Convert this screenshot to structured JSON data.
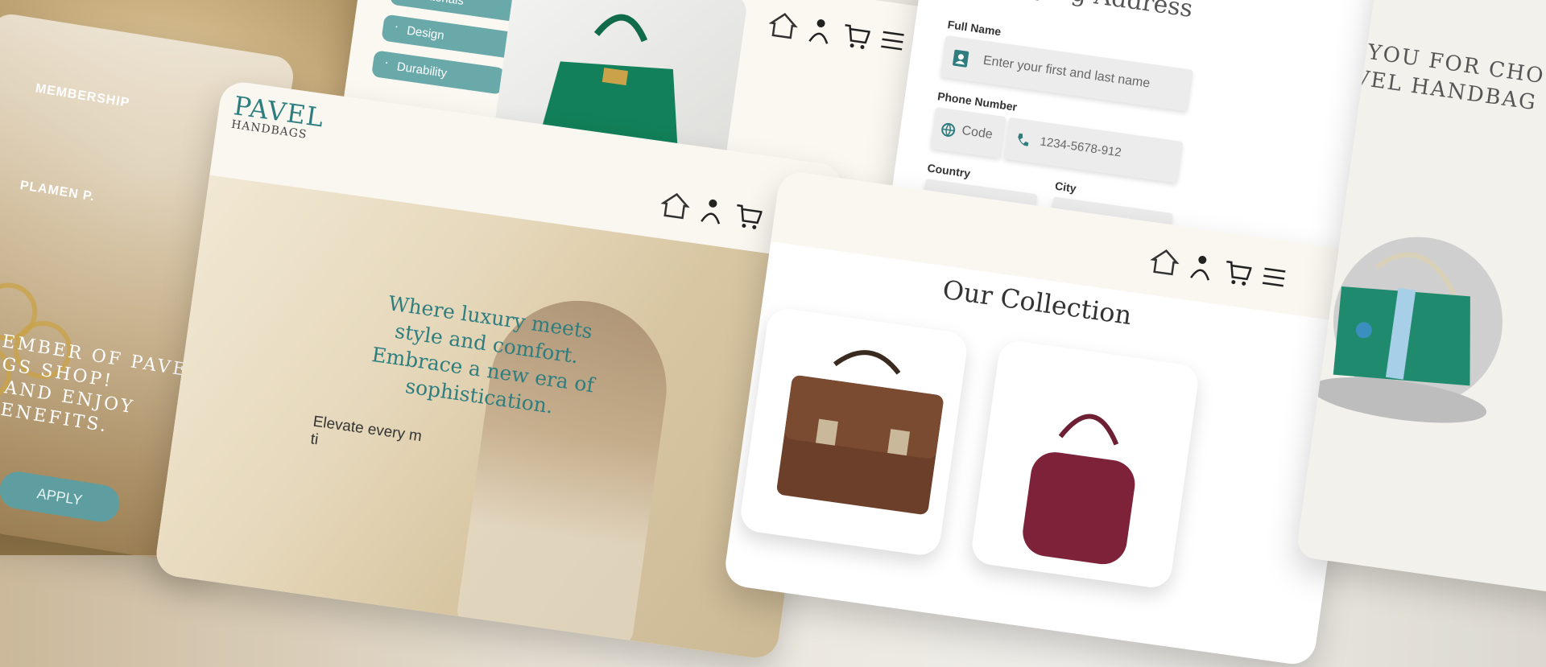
{
  "membership": {
    "label": "MEMBERSHIP",
    "name": "PLAMEN P.",
    "promo_line1": "A MEMBER OF PAVEL",
    "promo_line2": "DBAGS SHOP!",
    "promo_line3": "DAY AND ENJOY",
    "promo_line4": "AL BENEFITS.",
    "apply_label": "APPLY"
  },
  "product_page": {
    "menu": [
      "Materials",
      "Design",
      "Durability"
    ]
  },
  "brand": {
    "logo_top": "PAVEL",
    "logo_bottom": "HANDBAGS",
    "accent": "#2f7d7e"
  },
  "shipping": {
    "title": "Shipping Address",
    "full_name_label": "Full Name",
    "full_name_placeholder": "Enter your first and last name",
    "phone_label": "Phone Number",
    "code_placeholder": "Code",
    "phone_placeholder": "1234-5678-912",
    "country_label": "Country",
    "city_label": "City"
  },
  "hero": {
    "headline_1": "Where luxury meets",
    "headline_2": "style and comfort.",
    "headline_3": "Embrace a new era of",
    "headline_4": "sophistication.",
    "body_1": "Elevate every m",
    "body_2": "ti"
  },
  "collection": {
    "title": "Our Collection"
  },
  "thanks": {
    "line1": "K YOU FOR CHO",
    "line2": "AVEL HANDBAG"
  },
  "icons": [
    "home-icon",
    "user-icon",
    "cart-icon",
    "menu-icon",
    "contact-card-icon",
    "globe-icon",
    "phone-icon"
  ]
}
